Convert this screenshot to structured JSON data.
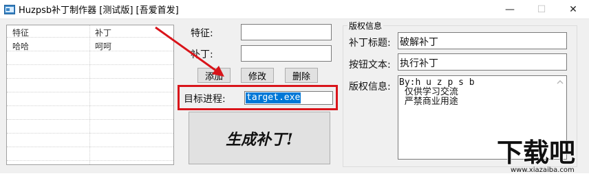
{
  "window": {
    "title": "Huzpsb补丁制作器 [测试版] [吾爱首发]",
    "minimize_glyph": "—",
    "maximize_glyph": "☐",
    "close_glyph": "✕"
  },
  "list": {
    "columns": [
      "特征",
      "补丁"
    ],
    "rows": [
      [
        "哈哈",
        "呵呵"
      ]
    ]
  },
  "form": {
    "feature_label": "特征:",
    "feature_value": "",
    "patch_label": "补丁:",
    "patch_value": "",
    "add_button": "添加",
    "modify_button": "修改",
    "delete_button": "删除",
    "target_label": "目标进程:",
    "target_value": "target.exe",
    "generate_button": "生成补丁!"
  },
  "copyright": {
    "group_title": "版权信息",
    "patch_title_label": "补丁标题:",
    "patch_title_value": "破解补丁",
    "button_text_label": "按钮文本:",
    "button_text_value": "执行补丁",
    "info_label": "版权信息:",
    "info_line1": "By:h u z p s b",
    "info_line2": " 仅供学习交流",
    "info_line3": " 严禁商业用途"
  },
  "watermark": {
    "logo_text": "下载吧",
    "site": "www.xiazaiba.com"
  },
  "colors": {
    "highlight_box": "#d9141a",
    "selection": "#0078d7",
    "annotation_arrow": "#d9141a"
  }
}
